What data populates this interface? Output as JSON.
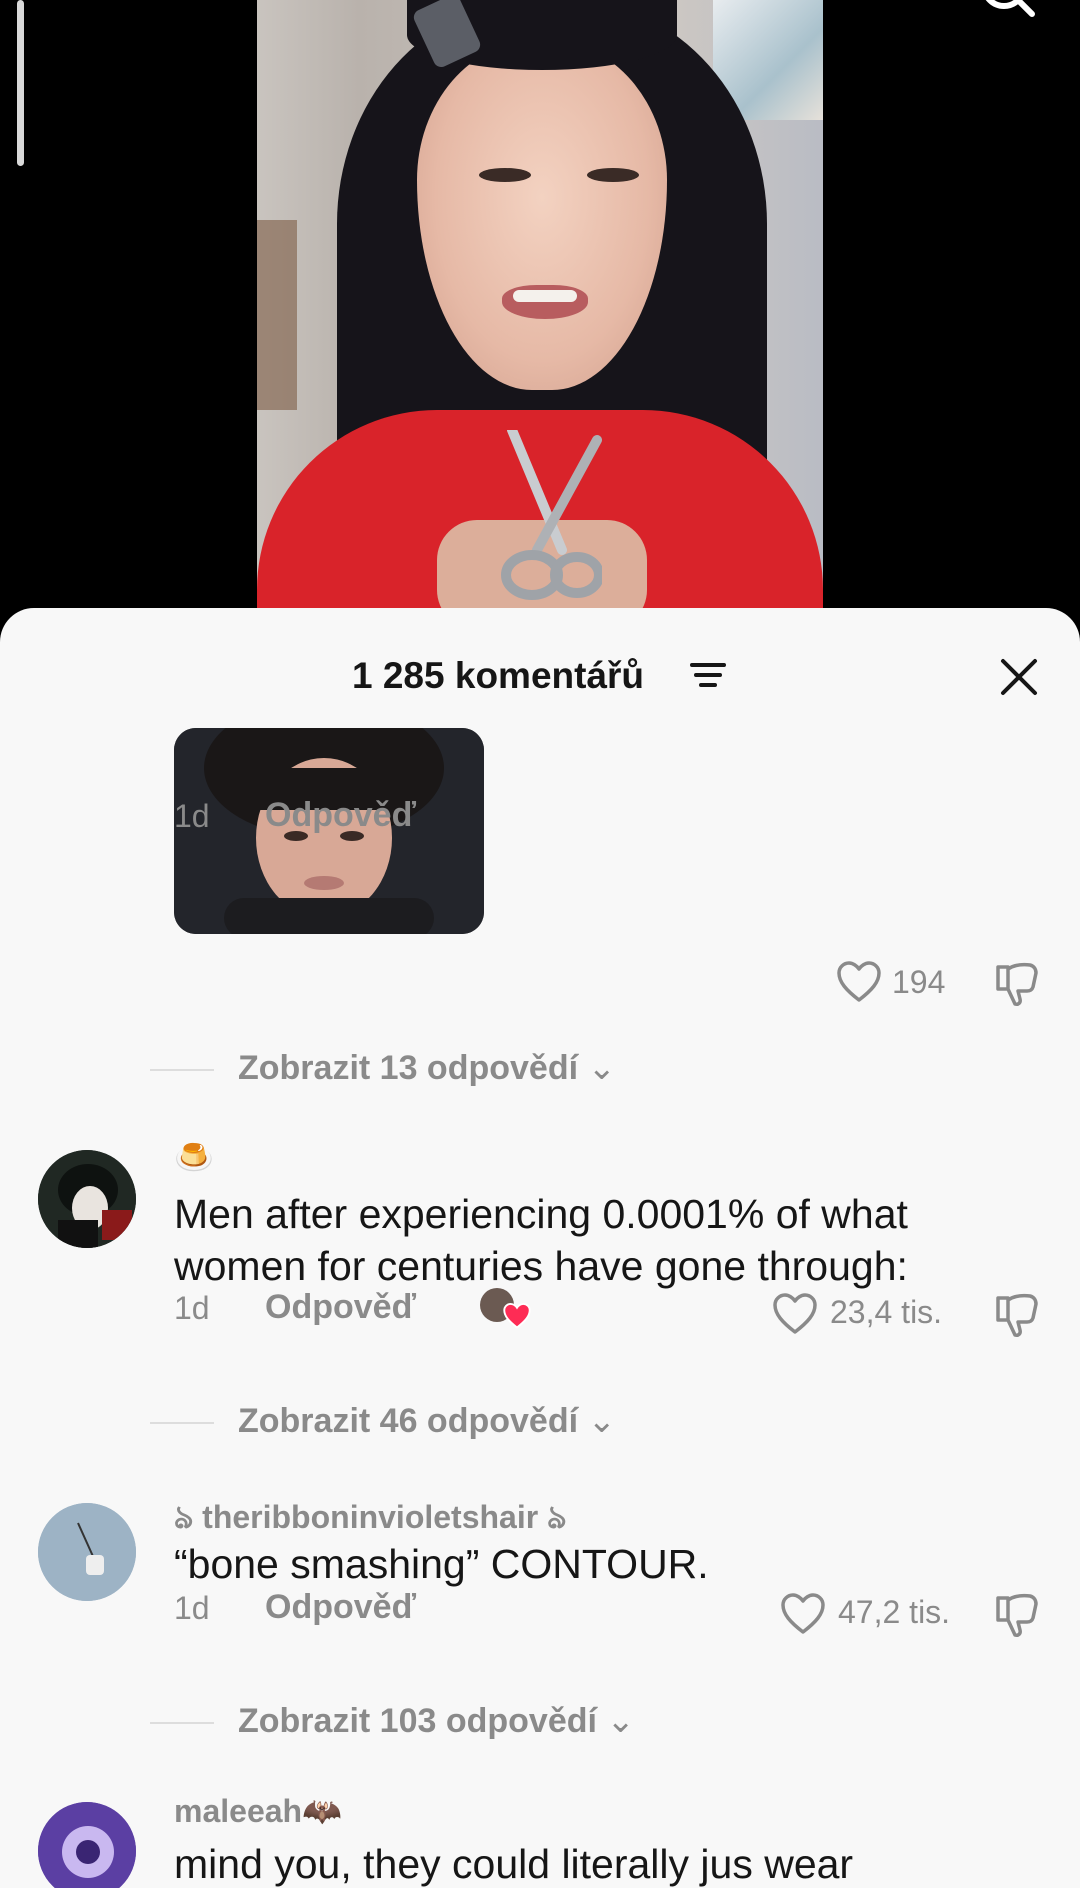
{
  "video": {
    "icons": {
      "search": "search-icon",
      "scrubber": "progress-scrubber"
    }
  },
  "sheet": {
    "title": "1 285 komentářů",
    "icons": {
      "sort": "sort-icon",
      "close": "close-icon"
    }
  },
  "comments": [
    {
      "time": "1d",
      "reply_label": "Odpověď",
      "likes": "194",
      "view_replies": "Zobrazit 13 odpovědí"
    },
    {
      "username_emoji": "🍮",
      "text": "Men after experiencing 0.0001% of what women for centuries have gone through:",
      "time": "1d",
      "reply_label": "Odpověď",
      "likes": "23,4 tis.",
      "view_replies": "Zobrazit 46 odpovědí"
    },
    {
      "username": "ঌ theribboninvioletshair ঌ",
      "text": "“bone smashing” CONTOUR.",
      "time": "1d",
      "reply_label": "Odpověď",
      "likes": "47,2 tis.",
      "view_replies": "Zobrazit 103 odpovědí"
    },
    {
      "username": "maleeah🦇",
      "text": "mind you, they could literally jus wear"
    }
  ],
  "colors": {
    "sheet_bg": "#f8f8f8",
    "text": "#161616",
    "muted": "#8a8a8a",
    "heart_red": "#fe2c55"
  }
}
